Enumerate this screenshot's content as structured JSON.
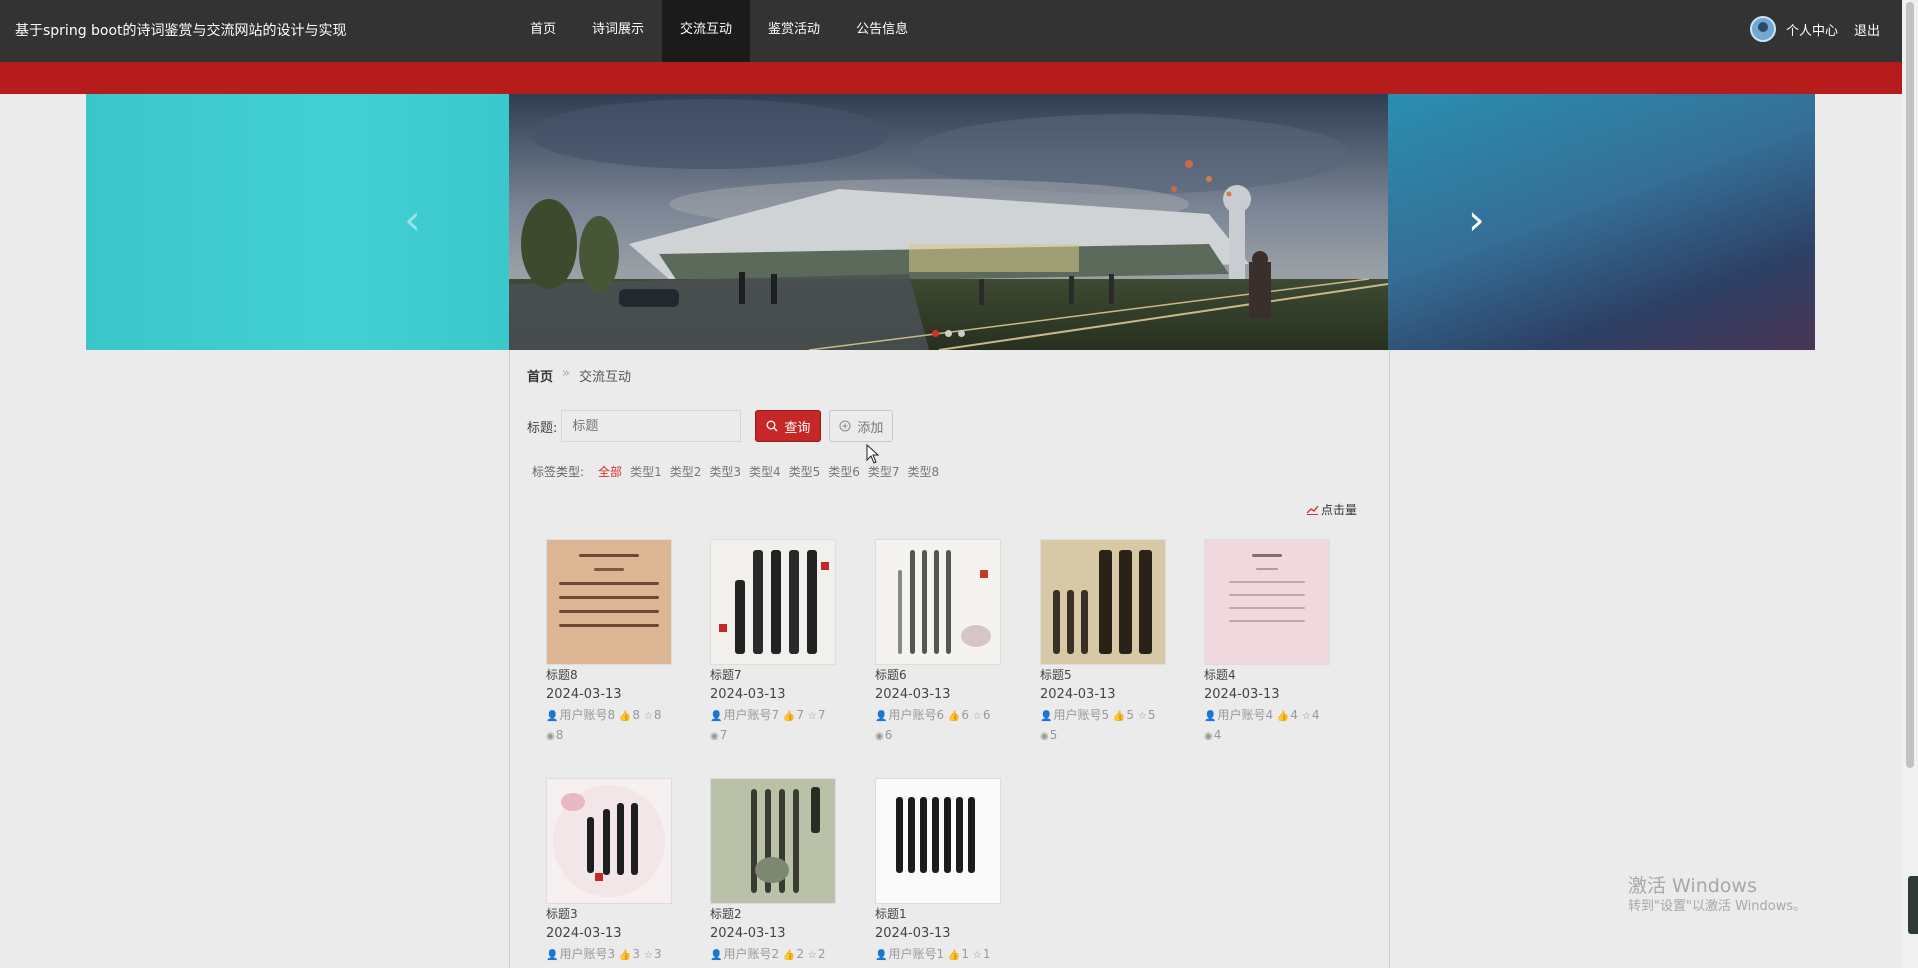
{
  "site": {
    "title": "基于spring boot的诗词鉴赏与交流网站的设计与实现"
  },
  "nav": {
    "items": [
      {
        "label": "首页"
      },
      {
        "label": "诗词展示"
      },
      {
        "label": "交流互动"
      },
      {
        "label": "鉴赏活动"
      },
      {
        "label": "公告信息"
      }
    ],
    "active_index": 2
  },
  "user": {
    "center_label": "个人中心",
    "logout_label": "退出"
  },
  "carousel": {
    "dot_count": 3,
    "active_dot": 0
  },
  "breadcrumb": {
    "home": "首页",
    "separator": "»",
    "current": "交流互动"
  },
  "search": {
    "label": "标题:",
    "placeholder": "标题",
    "query_label": "查询",
    "add_label": "添加"
  },
  "tags": {
    "label": "标签类型:",
    "items": [
      "全部",
      "类型1",
      "类型2",
      "类型3",
      "类型4",
      "类型5",
      "类型6",
      "类型7",
      "类型8"
    ],
    "active_index": 0
  },
  "sort": {
    "label": "点击量"
  },
  "cards": [
    {
      "title": "标题8",
      "date": "2024-03-13",
      "user": "用户账号8",
      "likes": "8",
      "favs": "8",
      "views": "8"
    },
    {
      "title": "标题7",
      "date": "2024-03-13",
      "user": "用户账号7",
      "likes": "7",
      "favs": "7",
      "views": "7"
    },
    {
      "title": "标题6",
      "date": "2024-03-13",
      "user": "用户账号6",
      "likes": "6",
      "favs": "6",
      "views": "6"
    },
    {
      "title": "标题5",
      "date": "2024-03-13",
      "user": "用户账号5",
      "likes": "5",
      "favs": "5",
      "views": "5"
    },
    {
      "title": "标题4",
      "date": "2024-03-13",
      "user": "用户账号4",
      "likes": "4",
      "favs": "4",
      "views": "4"
    },
    {
      "title": "标题3",
      "date": "2024-03-13",
      "user": "用户账号3",
      "likes": "3",
      "favs": "3",
      "views": ""
    },
    {
      "title": "标题2",
      "date": "2024-03-13",
      "user": "用户账号2",
      "likes": "2",
      "favs": "2",
      "views": ""
    },
    {
      "title": "标题1",
      "date": "2024-03-13",
      "user": "用户账号1",
      "likes": "1",
      "favs": "1",
      "views": ""
    }
  ],
  "watermark": {
    "title": "激活 Windows",
    "subtitle": "转到\"设置\"以激活 Windows。"
  },
  "colors": {
    "primary": "#c62828",
    "topbar": "#333333",
    "redbar": "#b71c1c"
  },
  "icons": {
    "user": "user-icon",
    "like": "thumbs-up-icon",
    "fav": "star-icon",
    "view": "eye-icon",
    "query": "search-icon",
    "add": "plus-circle-icon",
    "sort": "trend-icon"
  }
}
